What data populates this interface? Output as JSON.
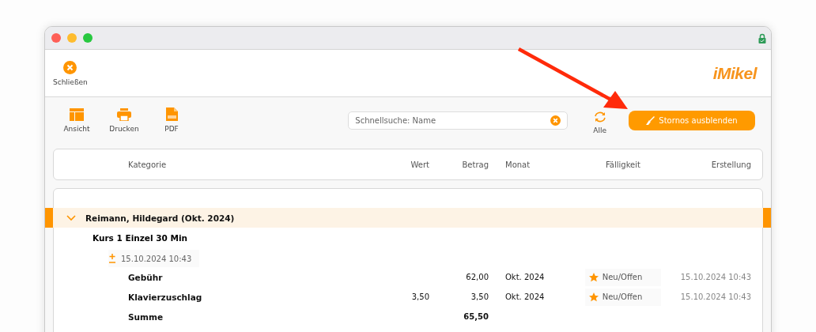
{
  "toolbar": {
    "close_label": "Schließen",
    "logo": "iMikel"
  },
  "tools": [
    {
      "kind": "view",
      "label": "Ansicht"
    },
    {
      "kind": "print",
      "label": "Drucken"
    },
    {
      "kind": "pdf",
      "label": "PDF"
    }
  ],
  "search": {
    "placeholder": "Schnellsuche: Name"
  },
  "refresh": {
    "label": "Alle"
  },
  "hide_button": {
    "label": "Stornos ausblenden"
  },
  "table": {
    "columns": [
      "Kategorie",
      "Wert",
      "Betrag",
      "Monat",
      "Fälligkeit",
      "Erstellung"
    ],
    "groups": [
      {
        "title": "Reimann, Hildegard (Okt. 2024)",
        "expanded": true,
        "selected": true,
        "course": "Kurs 1 Einzel 30 Min",
        "date": "15.10.2024 10:43",
        "rows": [
          {
            "kind": "item",
            "category": "Gebühr",
            "value": "",
            "amount": "62,00",
            "month": "Okt. 2024",
            "due": "Neu/Offen",
            "created": "15.10.2024 10:43"
          },
          {
            "kind": "item",
            "category": "Klavierzuschlag",
            "value": "3,50",
            "amount": "3,50",
            "month": "Okt. 2024",
            "due": "Neu/Offen",
            "created": "15.10.2024 10:43"
          },
          {
            "kind": "sum",
            "category": "Summe",
            "amount": "65,50"
          }
        ]
      }
    ]
  }
}
